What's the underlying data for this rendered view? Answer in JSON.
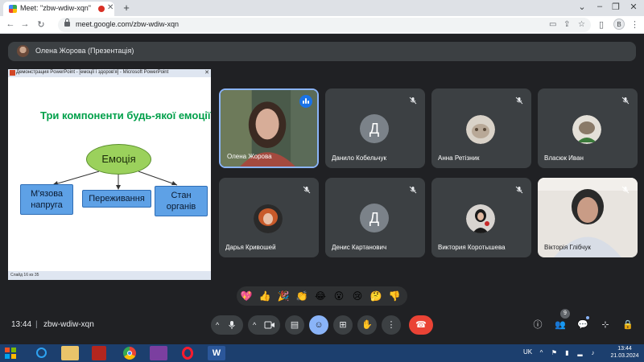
{
  "browser": {
    "tab_title": "Meet: \"zbw-wdiw-xqn\"",
    "tab_close": "✕",
    "new_tab": "+",
    "url": "meet.google.com/zbw-wdiw-xqn",
    "profile_initial": "B"
  },
  "presenter": {
    "name": "Олена Жорова (Презентація)"
  },
  "presentation": {
    "window_title": "Демонстрация PowerPoint - [емоції і здоров'я] - Microsoft PowerPoint",
    "heading": "Три компоненти будь-якої емоції",
    "center": "Емоція",
    "box_left_line1": "М'язова",
    "box_left_line2": "напруга",
    "box_middle": "Переживання",
    "box_right_line1": "Стан",
    "box_right_line2": "органів",
    "status": "Слайд 16 из 35"
  },
  "participants": [
    {
      "name": "Олена Жорова",
      "avatar": "",
      "kind": "video"
    },
    {
      "name": "Данило Кобельчук",
      "avatar": "Д",
      "kind": "letter"
    },
    {
      "name": "Анна Ретізник",
      "avatar": "",
      "kind": "photo"
    },
    {
      "name": "Власюк Иван",
      "avatar": "",
      "kind": "photo"
    },
    {
      "name": "Дарья Кривошей",
      "avatar": "",
      "kind": "photo"
    },
    {
      "name": "Денис Картанович",
      "avatar": "Д",
      "kind": "letter"
    },
    {
      "name": "Виктория Коротышева",
      "avatar": "",
      "kind": "photo"
    },
    {
      "name": "Вікторія Глібчук",
      "avatar": "",
      "kind": "video"
    }
  ],
  "reactions": [
    "💖",
    "👍",
    "🎉",
    "👏",
    "😂",
    "😮",
    "😢",
    "🤔",
    "👎"
  ],
  "meeting": {
    "time": "13:44",
    "separator": "|",
    "code": "zbw-wdiw-xqn",
    "people_count": "9"
  },
  "taskbar": {
    "lang": "UK",
    "time": "13:44",
    "date": "21.03.2024"
  },
  "colors": {
    "meet_bg": "#202124",
    "tile_bg": "#3c4043",
    "active_speaker": "#8ab4f8",
    "leave_red": "#ea4335",
    "slide_heading": "#00a04a",
    "slide_box": "#5ea1e6",
    "slide_oval": "#9bd15c"
  }
}
